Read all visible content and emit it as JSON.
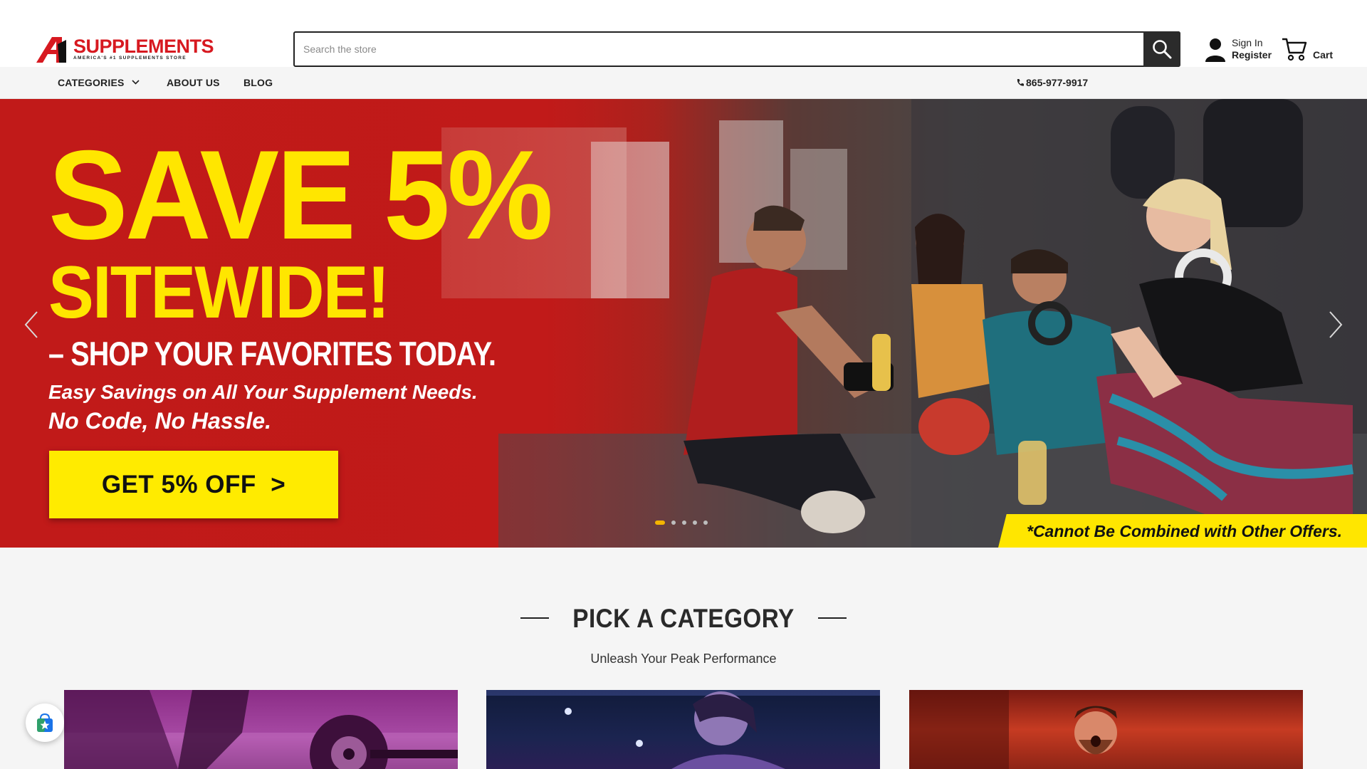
{
  "header": {
    "logo": {
      "word": "SUPPLEMENTS",
      "tagline": "AMERICA'S #1 SUPPLEMENTS STORE",
      "brand_color": "#d71920"
    },
    "search": {
      "placeholder": "Search the store",
      "button_icon": "search-icon"
    },
    "account": {
      "sign_in": "Sign In",
      "register": "Register",
      "icon": "user-icon"
    },
    "cart": {
      "label": "Cart",
      "icon": "cart-icon"
    }
  },
  "nav": {
    "items": [
      {
        "label": "CATEGORIES",
        "icon": "chevron-down-icon"
      },
      {
        "label": "ABOUT US"
      },
      {
        "label": "BLOG"
      }
    ],
    "phone": "865-977-9917"
  },
  "hero": {
    "headline_1": "SAVE 5%",
    "headline_2": "SITEWIDE!",
    "headline_3": "– SHOP YOUR FAVORITES TODAY.",
    "subline_1": "Easy Savings on All Your Supplement Needs.",
    "subline_2": "No Code, No Hassle.",
    "cta": "GET 5% OFF  >",
    "disclaimer": "*Cannot Be Combined with Other Offers.",
    "slide_count": 5,
    "active_slide": 1,
    "colors": {
      "accent": "#ffe600",
      "red": "#c11a19",
      "dot_active": "#f4b400"
    }
  },
  "categories": {
    "title": "PICK A CATEGORY",
    "subtitle": "Unleash Your Peak Performance",
    "cards": [
      {
        "name": "category-card-1"
      },
      {
        "name": "category-card-2"
      },
      {
        "name": "category-card-3"
      }
    ]
  },
  "floating_badge": {
    "icon": "shopping-bag-star-icon"
  }
}
